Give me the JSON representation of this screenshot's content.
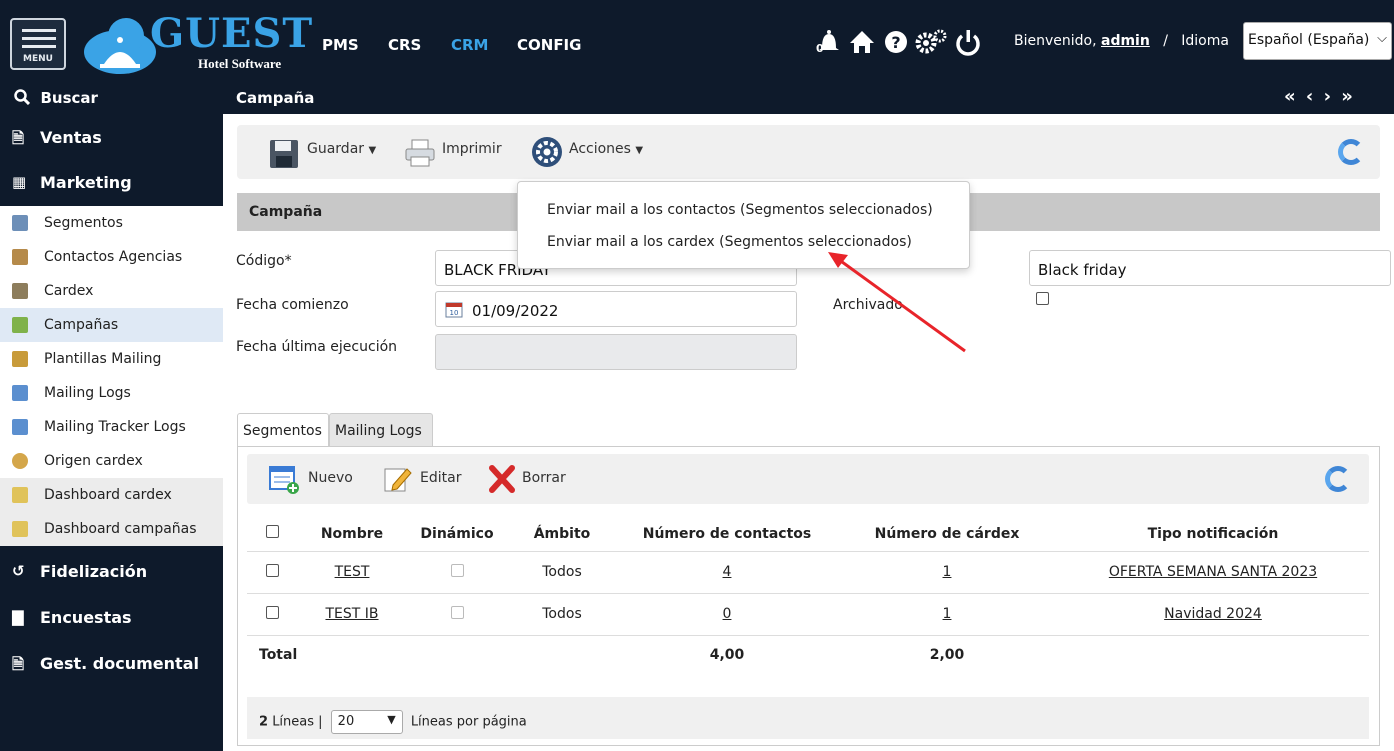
{
  "header": {
    "menu_label": "MENU",
    "brand": "GUEST",
    "brand_sub": "Hotel Software",
    "nav": [
      {
        "label": "PMS",
        "active": false
      },
      {
        "label": "CRS",
        "active": false
      },
      {
        "label": "CRM",
        "active": true
      },
      {
        "label": "CONFIG",
        "active": false
      }
    ],
    "notification_count": "0",
    "welcome_prefix": "Bienvenido,",
    "username": "admin",
    "separator": "/",
    "language_label": "Idioma",
    "language_value": "Español (España)"
  },
  "subbar": {
    "search_label": "Buscar",
    "page_title": "Campaña",
    "pager_arrows": "« ‹ › »"
  },
  "sidebar": {
    "groups_top": [
      {
        "label": "Ventas",
        "icon": "document-icon"
      },
      {
        "label": "Marketing",
        "icon": "marketing-icon"
      }
    ],
    "items": [
      {
        "label": "Segmentos",
        "icon": "segments-icon"
      },
      {
        "label": "Contactos Agencias",
        "icon": "contacts-icon"
      },
      {
        "label": "Cardex",
        "icon": "cardex-icon"
      },
      {
        "label": "Campañas",
        "icon": "campaigns-icon"
      },
      {
        "label": "Plantillas Mailing",
        "icon": "mail-template-icon"
      },
      {
        "label": "Mailing Logs",
        "icon": "log-icon"
      },
      {
        "label": "Mailing Tracker Logs",
        "icon": "log-icon"
      },
      {
        "label": "Origen cardex",
        "icon": "origin-icon"
      },
      {
        "label": "Dashboard cardex",
        "icon": "dashboard-icon"
      },
      {
        "label": "Dashboard campañas",
        "icon": "dashboard-icon"
      }
    ],
    "groups_bottom": [
      {
        "label": "Fidelización",
        "icon": "history-icon"
      },
      {
        "label": "Encuestas",
        "icon": "chart-icon"
      },
      {
        "label": "Gest. documental",
        "icon": "document-icon"
      }
    ]
  },
  "toolbar": {
    "save_label": "Guardar",
    "print_label": "Imprimir",
    "actions_label": "Acciones"
  },
  "dropdown": {
    "items": [
      "Enviar mail a los contactos (Segmentos seleccionados)",
      "Enviar mail a los cardex (Segmentos seleccionados)"
    ]
  },
  "form": {
    "section_title": "Campaña",
    "code_label": "Código*",
    "code_value": "BLACK FRIDAY",
    "start_label": "Fecha comienzo",
    "start_value": "01/09/2022",
    "last_exec_label": "Fecha última ejecución",
    "last_exec_value": "",
    "name_value": "Black friday",
    "archived_label": "Archivado"
  },
  "tabs": [
    {
      "label": "Segmentos",
      "active": true
    },
    {
      "label": "Mailing Logs",
      "active": false
    }
  ],
  "grid_toolbar": {
    "new_label": "Nuevo",
    "edit_label": "Editar",
    "delete_label": "Borrar"
  },
  "table": {
    "columns": [
      "Nombre",
      "Dinámico",
      "Ámbito",
      "Número de contactos",
      "Número de cárdex",
      "Tipo notificación"
    ],
    "rows": [
      {
        "name": "TEST",
        "scope": "Todos",
        "contacts": "4",
        "cardex": "1",
        "notification": "OFERTA SEMANA SANTA 2023"
      },
      {
        "name": "TEST IB",
        "scope": "Todos",
        "contacts": "0",
        "cardex": "1",
        "notification": "Navidad 2024"
      }
    ],
    "total_label": "Total",
    "total_contacts": "4,00",
    "total_cardex": "2,00"
  },
  "pager": {
    "count": "2",
    "lines_label": "Líneas |",
    "page_size": "20",
    "per_page_label": "Líneas por página"
  },
  "colors": {
    "navy": "#0e1a2b",
    "accent": "#3aa3e6",
    "arrow": "#e8242a"
  }
}
